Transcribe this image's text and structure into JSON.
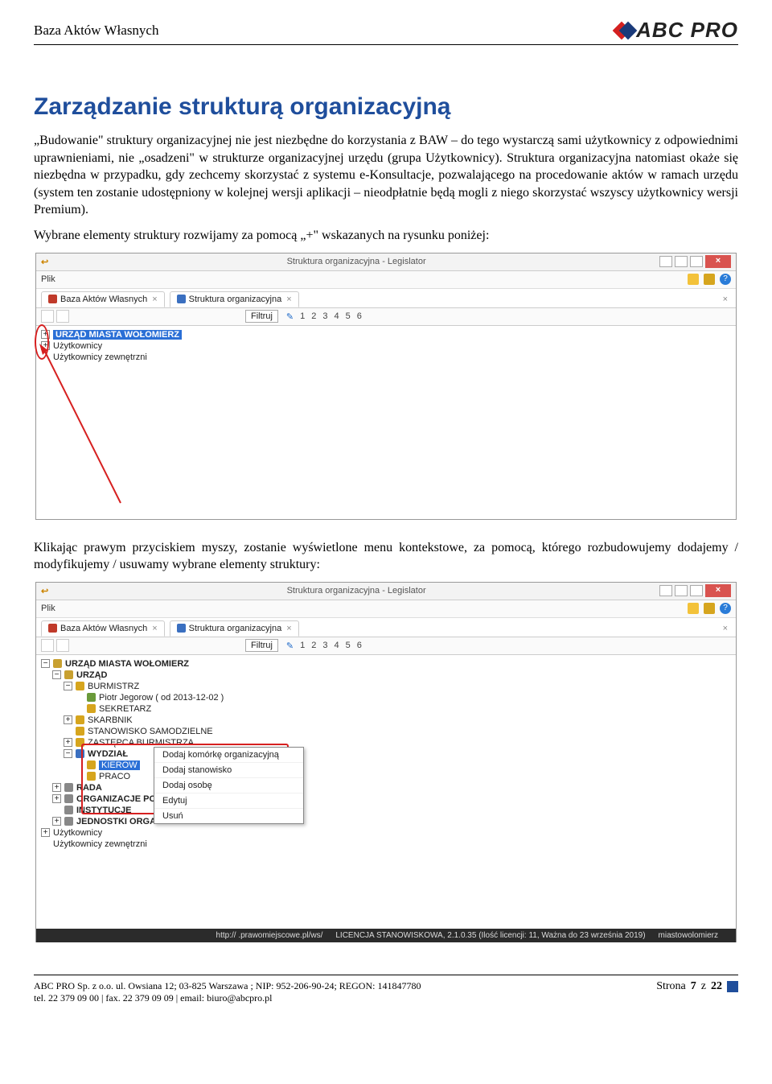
{
  "header": {
    "title": "Baza Aktów Własnych",
    "logo_text": "ABC PRO"
  },
  "heading": "Zarządzanie strukturą organizacyjną",
  "paragraphs": {
    "p1": "„Budowanie\" struktury organizacyjnej nie jest niezbędne do korzystania z BAW – do tego wystarczą sami użytkownicy z odpowiednimi uprawnieniami, nie „osadzeni\" w strukturze organizacyjnej urzędu (grupa Użytkownicy). Struktura organizacyjna natomiast okaże się niezbędna w przypadku, gdy zechcemy skorzystać z systemu e-Konsultacje, pozwalającego na procedowanie aktów w ramach urzędu (system ten zostanie udostępniony w kolejnej wersji aplikacji – nieodpłatnie będą mogli z niego skorzystać wszyscy użytkownicy wersji Premium).",
    "p2": "Wybrane elementy struktury rozwijamy za pomocą „+\" wskazanych na rysunku poniżej:",
    "p3": "Klikając prawym przyciskiem myszy, zostanie wyświetlone menu kontekstowe, za pomocą, którego rozbudowujemy dodajemy / modyfikujemy / usuwamy wybrane elementy struktury:"
  },
  "app1": {
    "title": "Struktura organizacyjna - Legislator",
    "menu_plik": "Plik",
    "tab1": "Baza Aktów Własnych",
    "tab2": "Struktura organizacyjna",
    "filter": "Filtruj",
    "levels": [
      "1",
      "2",
      "3",
      "4",
      "5",
      "6"
    ],
    "tree": {
      "n1": "URZĄD MIASTA WOŁOMIERZ",
      "n2": "Użytkownicy",
      "n3": "Użytkownicy zewnętrzni"
    }
  },
  "app2": {
    "title": "Struktura organizacyjna - Legislator",
    "menu_plik": "Plik",
    "tab1": "Baza Aktów Własnych",
    "tab2": "Struktura organizacyjna",
    "filter": "Filtruj",
    "levels": [
      "1",
      "2",
      "3",
      "4",
      "5",
      "6"
    ],
    "tree": {
      "r0": "URZĄD MIASTA WOŁOMIERZ",
      "r1": "URZĄD",
      "r2": "BURMISTRZ",
      "r3": "Piotr Jegorow ( od 2013-12-02 )",
      "r4": "SEKRETARZ",
      "r5": "SKARBNIK",
      "r6": "STANOWISKO SAMODZIELNE",
      "r7": "ZASTĘPCA BURMISTRZA",
      "r8": "WYDZIAŁ",
      "r9": "KIEROW",
      "r10": "PRACO",
      "r11": "RADA",
      "r12": "ORGANIZACJE POZA",
      "r13": "INSTYTUCJE",
      "r14": "JEDNOSTKI ORGANI",
      "r15": "Użytkownicy",
      "r16": "Użytkownicy zewnętrzni"
    },
    "context": {
      "i1": "Dodaj komórkę organizacyjną",
      "i2": "Dodaj stanowisko",
      "i3": "Dodaj osobę",
      "i4": "Edytuj",
      "i5": "Usuń"
    },
    "status": {
      "s1": "http://            .prawomiejscowe.pl/ws/",
      "s2": "LICENCJA STANOWISKOWA, 2.1.0.35 (Ilość licencji: 11, Ważna do 23 września 2019)",
      "s3": "miastowolomierz"
    }
  },
  "footer": {
    "line1": "ABC PRO Sp. z o.o. ul. Owsiana 12; 03-825 Warszawa ; NIP: 952-206-90-24; REGON: 141847780",
    "line2": "tel. 22 379 09 00 | fax. 22 379 09 09 | email: biuro@abcpro.pl",
    "page_prefix": "Strona ",
    "page_num": "7",
    "page_mid": " z ",
    "page_total": "22"
  }
}
